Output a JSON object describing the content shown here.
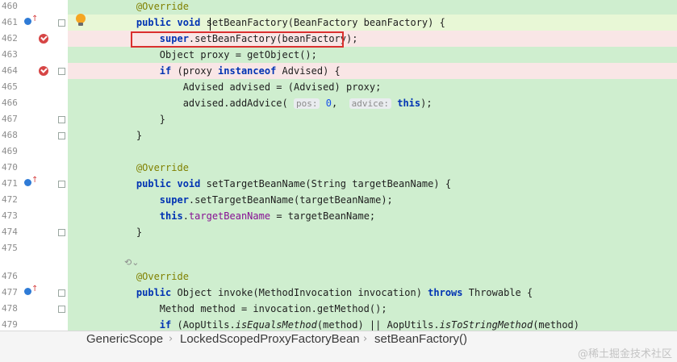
{
  "lines": [
    {
      "num": "460",
      "html": "    <span class=\"ann\">@Override</span>"
    },
    {
      "num": "461",
      "html": "    <span class=\"kw\">public void</span> setBeanFactory(BeanFactory beanFactory) {"
    },
    {
      "num": "462",
      "html": "        <span class=\"kw\">super</span>.setBeanFactory(beanFactory);"
    },
    {
      "num": "463",
      "html": "        Object proxy = getObject();"
    },
    {
      "num": "464",
      "html": "        <span class=\"kw\">if</span> (proxy <span class=\"kw\">instanceof</span> Advised) {"
    },
    {
      "num": "465",
      "html": "            Advised advised = (Advised) proxy;"
    },
    {
      "num": "466",
      "html": "            advised.addAdvice( <span class=\"hint\">pos:</span> <span class=\"num\">0</span>,  <span class=\"hint\">advice:</span> <span class=\"kw\">this</span>);"
    },
    {
      "num": "467",
      "html": "        }"
    },
    {
      "num": "468",
      "html": "    }"
    },
    {
      "num": "469",
      "html": ""
    },
    {
      "num": "470",
      "html": "    <span class=\"ann\">@Override</span>"
    },
    {
      "num": "471",
      "html": "    <span class=\"kw\">public void</span> setTargetBeanName(String targetBeanName) {"
    },
    {
      "num": "472",
      "html": "        <span class=\"kw\">super</span>.setTargetBeanName(targetBeanName);"
    },
    {
      "num": "473",
      "html": "        <span class=\"kw\">this</span>.<span class=\"fld\">targetBeanName</span> = targetBeanName;"
    },
    {
      "num": "474",
      "html": "    }"
    },
    {
      "num": "475",
      "html": ""
    },
    {
      "num": "476",
      "html": ""
    },
    {
      "num": "476",
      "html": "    <span class=\"ann\">@Override</span>"
    },
    {
      "num": "477",
      "html": "    <span class=\"kw\">public</span> Object invoke(MethodInvocation invocation) <span class=\"kw\">throws</span> Throwable {"
    },
    {
      "num": "478",
      "html": "        Method method = invocation.getMethod();"
    },
    {
      "num": "479",
      "html": "        <span class=\"kw\">if</span> (AopUtils.<span class=\"ital\">isEqualsMethod</span>(method) || AopUtils.<span class=\"ital\">isToStringMethod</span>(method)"
    }
  ],
  "breadcrumb": {
    "items": [
      "GenericScope",
      "LockedScopedProxyFactoryBean",
      "setBeanFactory()"
    ]
  },
  "watermark": "@稀土掘金技术社区",
  "icons": {
    "breakpoint": "breakpoint-icon",
    "override": "override-icon",
    "bulb": "intention-bulb-icon",
    "fold": "fold-icon",
    "ai": "ai-assistant-icon"
  },
  "colors": {
    "code_bg": "#cfeecf",
    "error_line_bg": "#f9e6e6",
    "keyword": "#0033b3",
    "annotation": "#808000",
    "highlight_box": "#d9302e"
  }
}
